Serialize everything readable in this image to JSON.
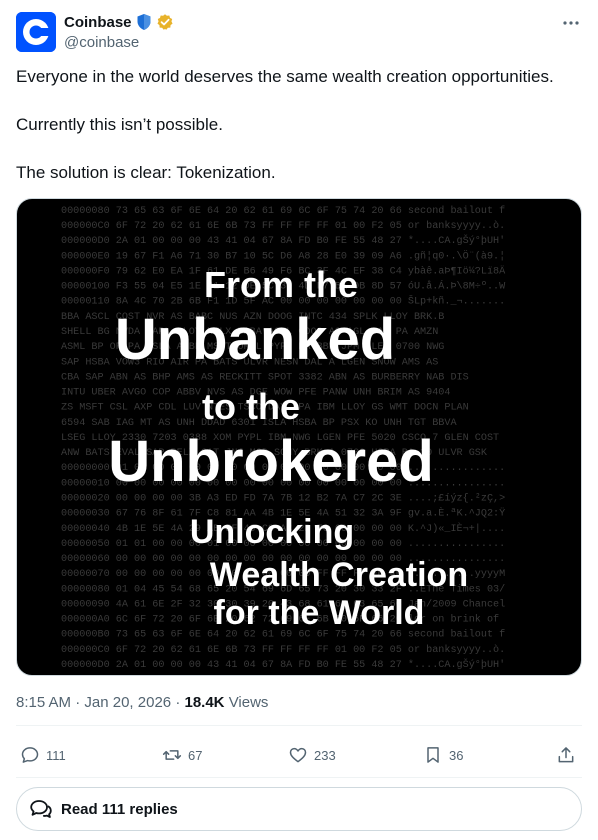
{
  "author": {
    "display_name": "Coinbase",
    "handle": "@coinbase",
    "brand_color": "#0052ff"
  },
  "tweet": {
    "lines": [
      "Everyone in the world deserves the same wealth creation opportunities.",
      "Currently this isn’t possible.",
      "The solution is clear: Tokenization."
    ]
  },
  "media": {
    "headline_1": "From the",
    "headline_2": "Unbanked",
    "headline_3": "to the",
    "headline_4": "Unbrokered",
    "sub_1": "Unlocking",
    "sub_2": "Wealth Creation",
    "sub_3": "for the World",
    "background_rows": [
      "00000080  73 65 63 6F 6E 64 20 62  61 69 6C 6F 75 74 20 66  second bailout f",
      "000000C0  6F 72 20 62 61 6E 6B 73  FF FF FF FF 01 00 F2 05  or banksyyyy..ò.",
      "000000D0  2A 01 00 00 00 43 41 04  67 8A FD B0 FE 55 48 27  *....CA.gŠý°þUH'",
      "000000E0  19 67 F1 A6 71 30 B7 10  5C D6 A8 28 E0 39 09 A6  .gñ¦q0·.\\Ö¨(à9.¦",
      "000000F0  79 62 E0 EA 1F 61 DE B6  49 F6 BC 3F 4C EF 38 C4  ybàê.aÞ¶Iö¼?Lï8Ä",
      "00000100  F3 55 04 E5 1E C1 12 DE  5C 38 4D F7 BA 0B 8D 57  óU.å.Á.Þ\\8M÷º..W",
      "00000110  8A 4C 70 2B 6B F1 1D 5F  AC 00 00 00 00 00 00 00  ŠLp+kñ._¬.......",
      "BBA ASCL COST NVR AS BABC NUS AZN DOOG INTC 434 SPLK LLOY BRK.B",
      "SHELL BG NVDA AAPL LLOY NFLX BABA ASML GOOG AS AGL SAF PA AMZN",
      "ASML BP OR PA TSLA ADBE MSFT ORCL PYPL MA BBD JPM GLEN 0700 NWG",
      "SAP HSBA VOW3 RIO AIR PA BATS ULVR NESN DAL A LGEN SNOW AMS AS",
      "CBA SAP ABN AS BHP AMS AS RECKITT SPOT 3382 ABN AS BURBERRY NAB DIS",
      "INTU UBER AVGO COP ABBV NVS AS DGE WOW PFE PANW UNH BRIM AS 9404",
      "ZS MSFT CSL AXP CDL LUV NTES TSCO DAY APA IBM LLOY GS WMT DOCN PLAN",
      "6594 SAB IAG MT AS UNH DDAD 6301 ISLA HSBA BP PSX KO UNH TGT BBVA",
      "LSEG LLOY 2330 7203 0388 XOM PYPL IBM NWG LGEN PFE 5020 CSCO 7 GLEN COST",
      "ANW BATS EVAL SAP RELX CAT JNJ MCD SONY BRK.A 0700 HSBA BA 10 ULVR GSK",
      "00000000  01 00 00 00 00 00 00 00  00 00 00 00 00 00 00 00  ................",
      "00000010  00 00 00 00 00 00 00 00  00 00 00 00 00 00 00 00  ................",
      "00000020  00 00 00 00 3B A3 ED FD  7A 7B 12 B2 7A C7 2C 3E  ....;£íýz{.²zÇ,>",
      "00000030  67 76 8F 61 7F C8 81 AA  4B 1E 5E 4A 51 32 3A 9F  gv.a.È.ªK.^JQ2:Ÿ",
      "00000040  4B 1E 5E 4A 29 AB 5F 49  C8 AC 2B 7C 00 00 00 00  K.^J)«_IÈ¬+|....",
      "00000050  01 01 00 00 00 01 00 00  00 00 00 00 00 00 00 00  ................",
      "00000060  00 00 00 00 00 00 00 00  00 00 00 00 00 00 00 00  ................",
      "00000070  00 00 00 00 00 00 00 00  00 00 00 FF FF FF FF 4D  ...........yyyyM",
      "00000080  01 04 45 54 68 65 20 54  69 6D 65 73 20 30 33 2F  ..EThe Times 03/",
      "00000090  4A 61 6E 2F 32 30 30 39  20 43 68 61 6E 63 65 6C  Jan/2009 Chancel",
      "000000A0  6C 6F 72 20 6F 6E 20 62  72 69 6E 6B 20 6F 66 20  lor on brink of ",
      "000000B0  73 65 63 6F 6E 64 20 62  61 69 6C 6F 75 74 20 66  second bailout f",
      "000000C0  6F 72 20 62 61 6E 6B 73  FF FF FF FF 01 00 F2 05  or banksyyyy..ò.",
      "000000D0  2A 01 00 00 00 43 41 04  67 8A FD B0 FE 55 48 27  *....CA.gŠý°þUH'"
    ]
  },
  "meta": {
    "time": "8:15 AM",
    "sep": "·",
    "date": "Jan 20, 2026",
    "views_count": "18.4K",
    "views_label": "Views"
  },
  "actions": {
    "replies": "111",
    "reposts": "67",
    "likes": "233",
    "bookmarks": "36"
  },
  "read_replies": "Read 111 replies"
}
